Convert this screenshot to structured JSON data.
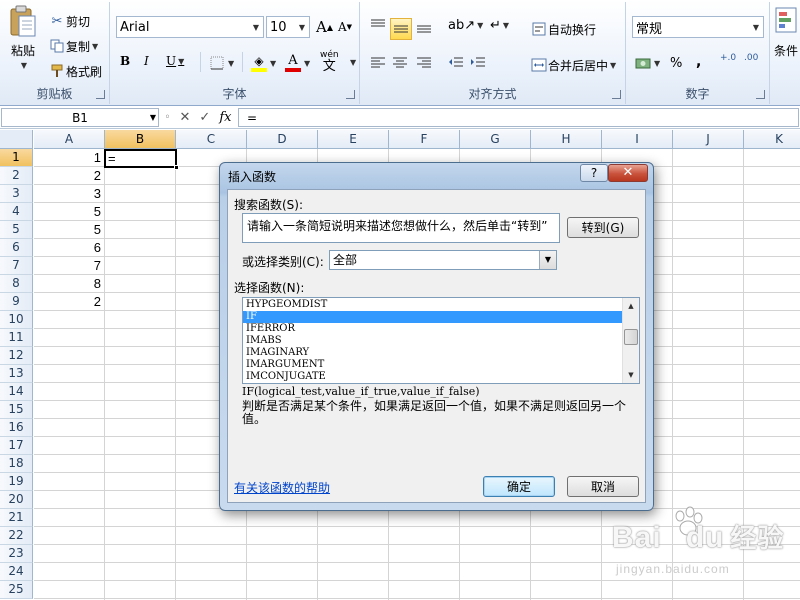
{
  "ribbon": {
    "clipboard": {
      "paste": "粘贴",
      "cut": "剪切",
      "copy": "复制",
      "format_painter": "格式刷",
      "label": "剪贴板"
    },
    "font": {
      "name": "Arial",
      "size": "10",
      "bold": "B",
      "italic": "I",
      "underline": "U",
      "label": "字体",
      "wen": "wén",
      "wen_char": "文"
    },
    "alignment": {
      "wrap_text": "自动换行",
      "merge_center": "合并后居中",
      "label": "对齐方式"
    },
    "number": {
      "format": "常规",
      "percent": "%",
      "comma": ",",
      "inc_decimal": ".0\n.00",
      "dec_decimal": ".00\n.0",
      "label": "数字",
      "inc_dec_short": "+.0",
      "dec_dec_short": ".00"
    },
    "styles": {
      "conditional_format": "条件"
    }
  },
  "formula_bar": {
    "name_box": "B1",
    "fx": "fx",
    "cancel": "✕",
    "enter": "✓",
    "content": "="
  },
  "sheet": {
    "columns": [
      "A",
      "B",
      "C",
      "D",
      "E",
      "F",
      "G",
      "H",
      "I",
      "J",
      "K"
    ],
    "rows": [
      "1",
      "2",
      "3",
      "4",
      "5",
      "6",
      "7",
      "8",
      "9",
      "10",
      "11",
      "12",
      "13",
      "14",
      "15",
      "16",
      "17",
      "18",
      "19",
      "20",
      "21",
      "22",
      "23",
      "24",
      "25"
    ],
    "column_a_values": [
      "1",
      "2",
      "3",
      "5",
      "5",
      "6",
      "7",
      "8",
      "2"
    ],
    "active_cell_value": "="
  },
  "dialog": {
    "title": "插入函数",
    "help": "?",
    "close": "✕",
    "search_label": "搜索函数(S):",
    "search_placeholder": "请输入一条简短说明来描述您想做什么，然后单击“转到”",
    "go_button": "转到(G)",
    "category_label": "或选择类别(C):",
    "category_value": "全部",
    "select_label": "选择函数(N):",
    "functions": [
      "HYPGEOMDIST",
      "IF",
      "IFERROR",
      "IMABS",
      "IMAGINARY",
      "IMARGUMENT",
      "IMCONJUGATE"
    ],
    "selected_function": "IF",
    "signature": "IF(logical_test,value_if_true,value_if_false)",
    "description": "判断是否满足某个条件，如果满足返回一个值，如果不满足则返回另一个值。",
    "help_link": "有关该函数的帮助",
    "ok_button": "确定",
    "cancel_button": "取消"
  },
  "watermark": {
    "logo_left": "Bai",
    "logo_right": "du",
    "logo_cn": "经验",
    "sub": "jingyan.baidu.com"
  }
}
